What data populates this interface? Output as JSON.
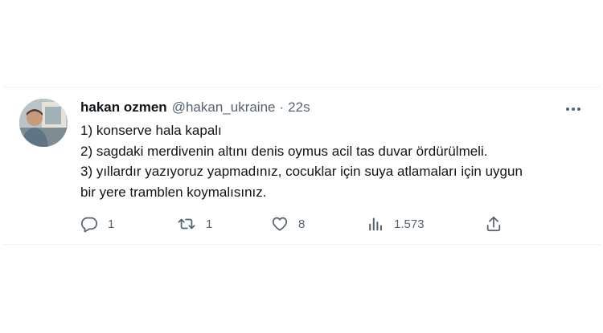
{
  "tweet": {
    "author_name": "hakan ozmen",
    "author_handle": "@hakan_ukraine",
    "separator": "·",
    "time": "22s",
    "lines": [
      "1) konserve hala kapalı",
      "2) sagdaki merdivenin altını denis oymus acil tas duvar ördürülmeli.",
      "3) yıllardır yazıyoruz yapmadınız, cocuklar için suya atlamaları için uygun",
      "bir yere tramblen koymalısınız."
    ],
    "actions": {
      "reply": {
        "icon": "reply-icon",
        "count": "1"
      },
      "retweet": {
        "icon": "retweet-icon",
        "count": "1"
      },
      "like": {
        "icon": "heart-icon",
        "count": "8"
      },
      "views": {
        "icon": "analytics-icon",
        "count": "1.573"
      },
      "share": {
        "icon": "share-icon"
      }
    },
    "more_icon": "more-icon"
  },
  "colors": {
    "text": "#0f1419",
    "secondary": "#536471",
    "border": "#eff3f4"
  }
}
